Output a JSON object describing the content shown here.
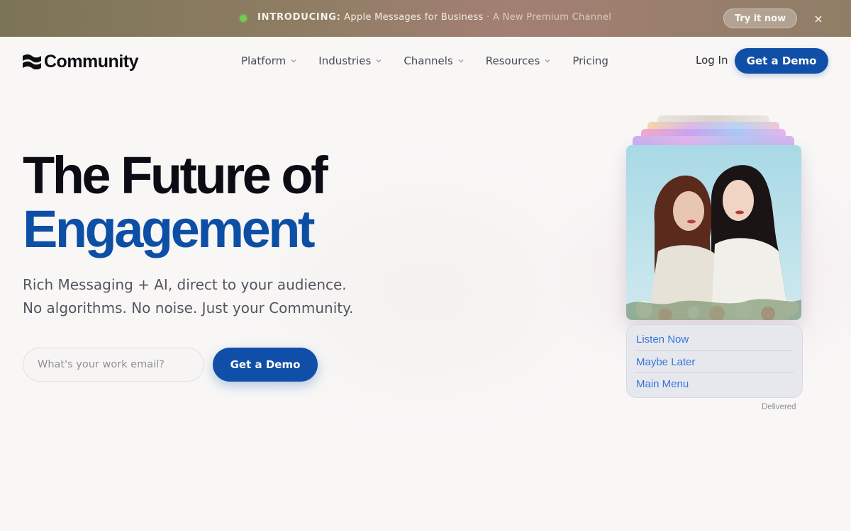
{
  "announcement": {
    "label": "INTRODUCING:",
    "message": "Apple Messages for Business",
    "separator": "·",
    "tagline": "A New Premium Channel",
    "cta": "Try it now",
    "close_icon": "×"
  },
  "brand": {
    "name": "Community",
    "logo_icon": "wave-flag-icon"
  },
  "nav": {
    "items": [
      {
        "label": "Platform",
        "has_dropdown": true
      },
      {
        "label": "Industries",
        "has_dropdown": true
      },
      {
        "label": "Channels",
        "has_dropdown": true
      },
      {
        "label": "Resources",
        "has_dropdown": true
      },
      {
        "label": "Pricing",
        "has_dropdown": false
      }
    ],
    "login": "Log In",
    "demo": "Get a Demo"
  },
  "hero": {
    "headline_line1": "The Future of",
    "headline_line2": "Engagement",
    "sub_line1": "Rich Messaging + AI, direct to your audience.",
    "sub_line2": "No algorithms. No noise. Just your Community.",
    "email_placeholder": "What's your work email?",
    "email_value": "",
    "cta": "Get a Demo"
  },
  "message_card": {
    "options": [
      "Listen Now",
      "Maybe Later",
      "Main Menu"
    ],
    "status": "Delivered"
  },
  "colors": {
    "primary": "#0f4fa8",
    "headline_accent": "#0d4fa5",
    "link_blue": "#3478d6",
    "status_dot": "#6fce52"
  }
}
